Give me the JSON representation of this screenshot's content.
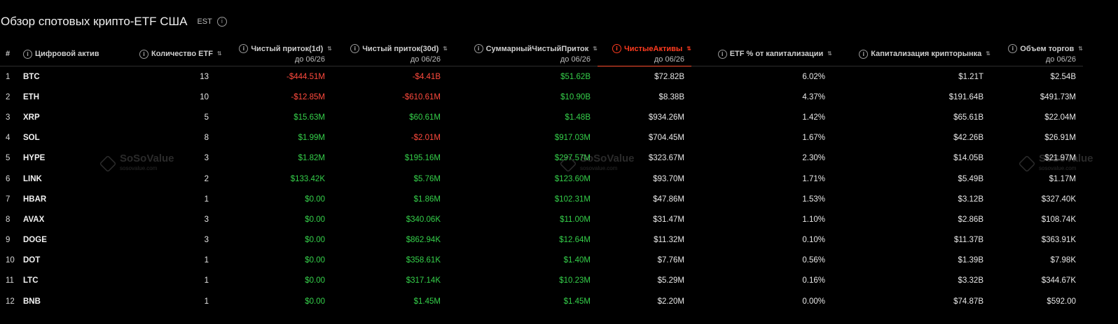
{
  "header": {
    "title": "Обзор спотовых крипто-ETF США",
    "timezone": "EST",
    "info_icon": "info-icon"
  },
  "columns": {
    "index": "#",
    "asset": "Цифровой актив",
    "etf_count": "Количество ETF",
    "inflow_1d": "Чистый приток(1d)",
    "inflow_30d": "Чистый приток(30d)",
    "cum_inflow": "СуммарныйЧистыйПриток",
    "net_assets": "ЧистыеАктивы",
    "etf_pct": "ETF % от капитализации",
    "market_cap": "Капитализация крипторынка",
    "volume": "Объем торгов",
    "date_sub": "до 06/26"
  },
  "rows": [
    {
      "n": "1",
      "sym": "BTC",
      "etf": "13",
      "d1": "-$444.51M",
      "d30": "-$4.41B",
      "cum": "$51.62B",
      "assets": "$72.82B",
      "pct": "6.02%",
      "cap": "$1.21T",
      "vol": "$2.54B"
    },
    {
      "n": "2",
      "sym": "ETH",
      "etf": "10",
      "d1": "-$12.85M",
      "d30": "-$610.61M",
      "cum": "$10.90B",
      "assets": "$8.38B",
      "pct": "4.37%",
      "cap": "$191.64B",
      "vol": "$491.73M"
    },
    {
      "n": "3",
      "sym": "XRP",
      "etf": "5",
      "d1": "$15.63M",
      "d30": "$60.61M",
      "cum": "$1.48B",
      "assets": "$934.26M",
      "pct": "1.42%",
      "cap": "$65.61B",
      "vol": "$22.04M"
    },
    {
      "n": "4",
      "sym": "SOL",
      "etf": "8",
      "d1": "$1.99M",
      "d30": "-$2.01M",
      "cum": "$917.03M",
      "assets": "$704.45M",
      "pct": "1.67%",
      "cap": "$42.26B",
      "vol": "$26.91M"
    },
    {
      "n": "5",
      "sym": "HYPE",
      "etf": "3",
      "d1": "$1.82M",
      "d30": "$195.16M",
      "cum": "$297.57M",
      "assets": "$323.67M",
      "pct": "2.30%",
      "cap": "$14.05B",
      "vol": "$21.97M"
    },
    {
      "n": "6",
      "sym": "LINK",
      "etf": "2",
      "d1": "$133.42K",
      "d30": "$5.76M",
      "cum": "$123.60M",
      "assets": "$93.70M",
      "pct": "1.71%",
      "cap": "$5.49B",
      "vol": "$1.17M"
    },
    {
      "n": "7",
      "sym": "HBAR",
      "etf": "1",
      "d1": "$0.00",
      "d30": "$1.86M",
      "cum": "$102.31M",
      "assets": "$47.86M",
      "pct": "1.53%",
      "cap": "$3.12B",
      "vol": "$327.40K"
    },
    {
      "n": "8",
      "sym": "AVAX",
      "etf": "3",
      "d1": "$0.00",
      "d30": "$340.06K",
      "cum": "$11.00M",
      "assets": "$31.47M",
      "pct": "1.10%",
      "cap": "$2.86B",
      "vol": "$108.74K"
    },
    {
      "n": "9",
      "sym": "DOGE",
      "etf": "3",
      "d1": "$0.00",
      "d30": "$862.94K",
      "cum": "$12.64M",
      "assets": "$11.32M",
      "pct": "0.10%",
      "cap": "$11.37B",
      "vol": "$363.91K"
    },
    {
      "n": "10",
      "sym": "DOT",
      "etf": "1",
      "d1": "$0.00",
      "d30": "$358.61K",
      "cum": "$1.40M",
      "assets": "$7.76M",
      "pct": "0.56%",
      "cap": "$1.39B",
      "vol": "$7.98K"
    },
    {
      "n": "11",
      "sym": "LTC",
      "etf": "1",
      "d1": "$0.00",
      "d30": "$317.14K",
      "cum": "$10.23M",
      "assets": "$5.29M",
      "pct": "0.16%",
      "cap": "$3.32B",
      "vol": "$344.67K"
    },
    {
      "n": "12",
      "sym": "BNB",
      "etf": "1",
      "d1": "$0.00",
      "d30": "$1.45M",
      "cum": "$1.45M",
      "assets": "$2.20M",
      "pct": "0.00%",
      "cap": "$74.87B",
      "vol": "$592.00"
    }
  ],
  "watermark": {
    "brand": "SoSoValue",
    "site": "sosovalue.com"
  },
  "colors": {
    "negative": "#ff4a3d",
    "positive": "#35d04a",
    "active_sort": "#ff3b1f",
    "background": "#000000"
  }
}
